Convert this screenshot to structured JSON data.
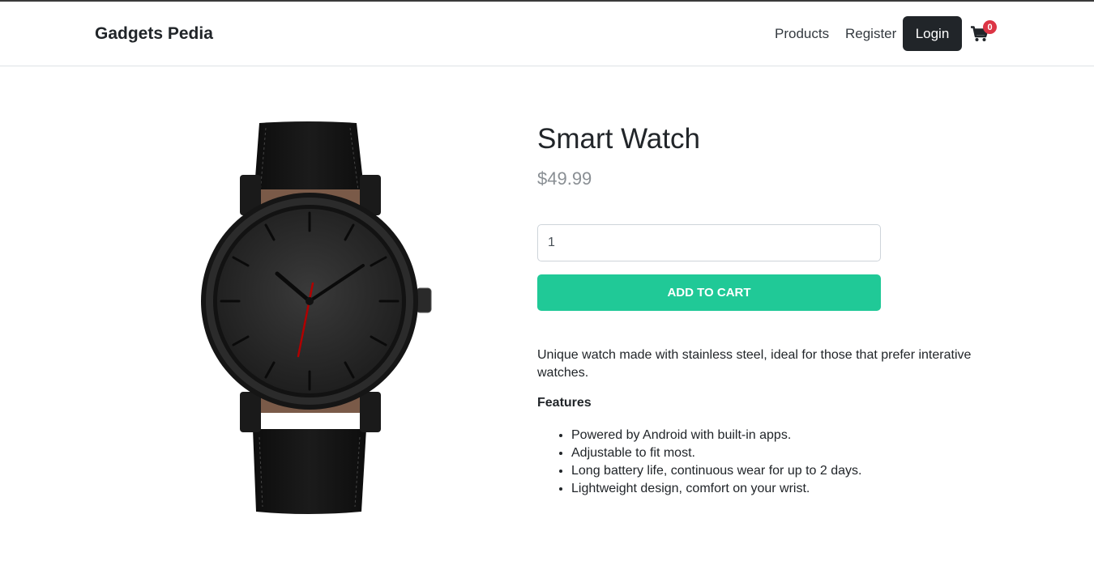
{
  "navbar": {
    "brand": "Gadgets Pedia",
    "links": [
      "Products",
      "Register"
    ],
    "login_label": "Login",
    "cart_icon": "cart-icon",
    "cart_count": "0"
  },
  "product": {
    "title": "Smart Watch",
    "price": "$49.99",
    "quantity": "1",
    "add_to_cart_label": "ADD TO CART",
    "description": "Unique watch made with stainless steel, ideal for those that prefer interative watches.",
    "features_heading": "Features",
    "features": [
      "Powered by Android with built-in apps.",
      "Adjustable to fit most.",
      "Long battery life, continuous wear for up to 2 days.",
      "Lightweight design, comfort on your wrist."
    ]
  },
  "colors": {
    "accent": "#20c997",
    "dark": "#212529",
    "badge": "#dc3545"
  }
}
